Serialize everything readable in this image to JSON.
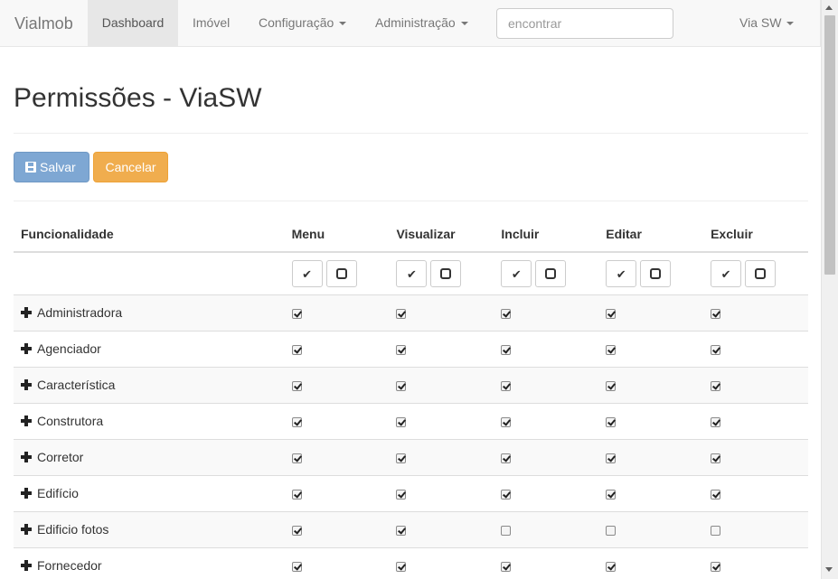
{
  "navbar": {
    "brand": "Vialmob",
    "items": [
      {
        "label": "Dashboard",
        "active": true,
        "dropdown": false
      },
      {
        "label": "Imóvel",
        "active": false,
        "dropdown": false
      },
      {
        "label": "Configuração",
        "active": false,
        "dropdown": true
      },
      {
        "label": "Administração",
        "active": false,
        "dropdown": true
      }
    ],
    "search_placeholder": "encontrar",
    "user_menu": "Via SW"
  },
  "page": {
    "title": "Permissões - ViaSW",
    "save_label": "Salvar",
    "cancel_label": "Cancelar"
  },
  "table": {
    "headers": [
      "Funcionalidade",
      "Menu",
      "Visualizar",
      "Incluir",
      "Editar",
      "Excluir"
    ],
    "rows": [
      {
        "name": "Administradora",
        "perms": [
          true,
          true,
          true,
          true,
          true
        ]
      },
      {
        "name": "Agenciador",
        "perms": [
          true,
          true,
          true,
          true,
          true
        ]
      },
      {
        "name": "Característica",
        "perms": [
          true,
          true,
          true,
          true,
          true
        ]
      },
      {
        "name": "Construtora",
        "perms": [
          true,
          true,
          true,
          true,
          true
        ]
      },
      {
        "name": "Corretor",
        "perms": [
          true,
          true,
          true,
          true,
          true
        ]
      },
      {
        "name": "Edifício",
        "perms": [
          true,
          true,
          true,
          true,
          true
        ]
      },
      {
        "name": "Edificio fotos",
        "perms": [
          true,
          true,
          false,
          false,
          false
        ]
      },
      {
        "name": "Fornecedor",
        "perms": [
          true,
          true,
          true,
          true,
          true
        ]
      }
    ]
  },
  "colors": {
    "save_button": "#7ea7d3",
    "cancel_button": "#f0ad4e",
    "navbar_bg": "#f8f8f8"
  }
}
